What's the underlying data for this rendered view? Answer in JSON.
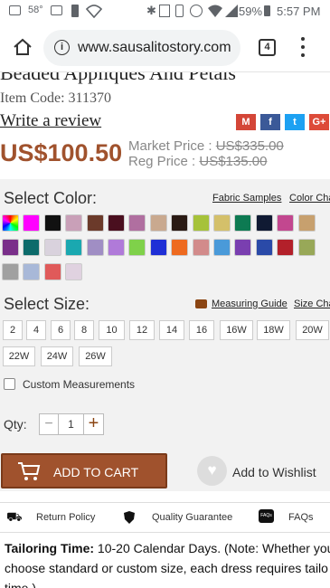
{
  "status_bar": {
    "signal_icon_text": "58°",
    "battery": "59%",
    "time": "5:57 PM"
  },
  "browser": {
    "url": "www.sausalitostory.com",
    "tab_count": "4"
  },
  "product": {
    "title": "Beaded Appliques And Petals",
    "item_code": "Item Code: 311370",
    "review_link": "Write a review",
    "price": "US$100.50",
    "market_price_label": "Market Price :",
    "market_price": "US$335.00",
    "reg_price_label": "Reg Price :",
    "reg_price": "US$135.00"
  },
  "share": {
    "gmail": "M",
    "facebook": "f",
    "twitter": "t",
    "google": "G+"
  },
  "color": {
    "heading": "Select Color:",
    "fabric_link": "Fabric Samples",
    "chart_link": "Color Cha",
    "swatches": [
      "#ff00ff",
      "#111111",
      "#c9a0b8",
      "#6b3a2a",
      "#4a0f1f",
      "#b06fa0",
      "#c9a98f",
      "#2a1a14",
      "#a6c23a",
      "#d4c06a",
      "#0d7a52",
      "#101a33",
      "#c2478f",
      "#c7a06e",
      "#7a2f8a",
      "#0d6b6b",
      "#d9d2dd",
      "#1aa8b0",
      "#a08ec4",
      "#b07ad9",
      "#7fd14a",
      "#1f2fd6",
      "#ee6a1f",
      "#d28b8b",
      "#4a9ad9",
      "#7a3fb0",
      "#2a4aa8",
      "#b3202a",
      "#98a858",
      "#a0a0a0",
      "#a8b8d8",
      "#e05a5a",
      "#e0d2e0"
    ]
  },
  "size": {
    "heading": "Select Size:",
    "guide_link": "Measuring Guide",
    "chart_link": "Size Cha",
    "options": [
      "2",
      "4",
      "6",
      "8",
      "10",
      "12",
      "14",
      "16",
      "16W",
      "18W",
      "20W",
      "22W",
      "24W",
      "26W"
    ]
  },
  "custom": {
    "label": "Custom Measurements"
  },
  "qty": {
    "label": "Qty:",
    "minus": "−",
    "value": "1",
    "plus": "+"
  },
  "actions": {
    "add_to_cart": "ADD TO CART",
    "wishlist": "Add to Wishlist"
  },
  "features": {
    "return": "Return Policy",
    "quality": "Quality Guarantee",
    "faqs": "FAQs",
    "faqs_icon_text": "FAQs"
  },
  "tailoring": {
    "label": "Tailoring Time:",
    "line1": " 10-20 Calendar Days. (Note: Whether you",
    "line2": "choose standard or custom size, each dress requires tailo",
    "line3": "time.)"
  },
  "colors": {
    "price": "#a0522d",
    "cart_button": "#a0522d",
    "accent_link": "#8b4513"
  }
}
